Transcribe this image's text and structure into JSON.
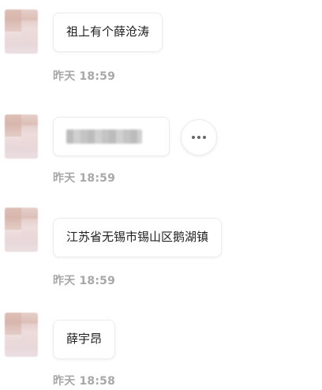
{
  "messages": [
    {
      "text": "祖上有个薛沧涛",
      "time": "昨天 18:59",
      "redacted": false
    },
    {
      "text": "",
      "time": "昨天 18:59",
      "redacted": true,
      "more_icon": "more-horizontal-icon"
    },
    {
      "text": "江苏省无锡市锡山区鹅湖镇",
      "time": "昨天 18:59",
      "redacted": false
    },
    {
      "text": "薛宇昂",
      "time": "昨天 18:58",
      "redacted": false
    }
  ]
}
